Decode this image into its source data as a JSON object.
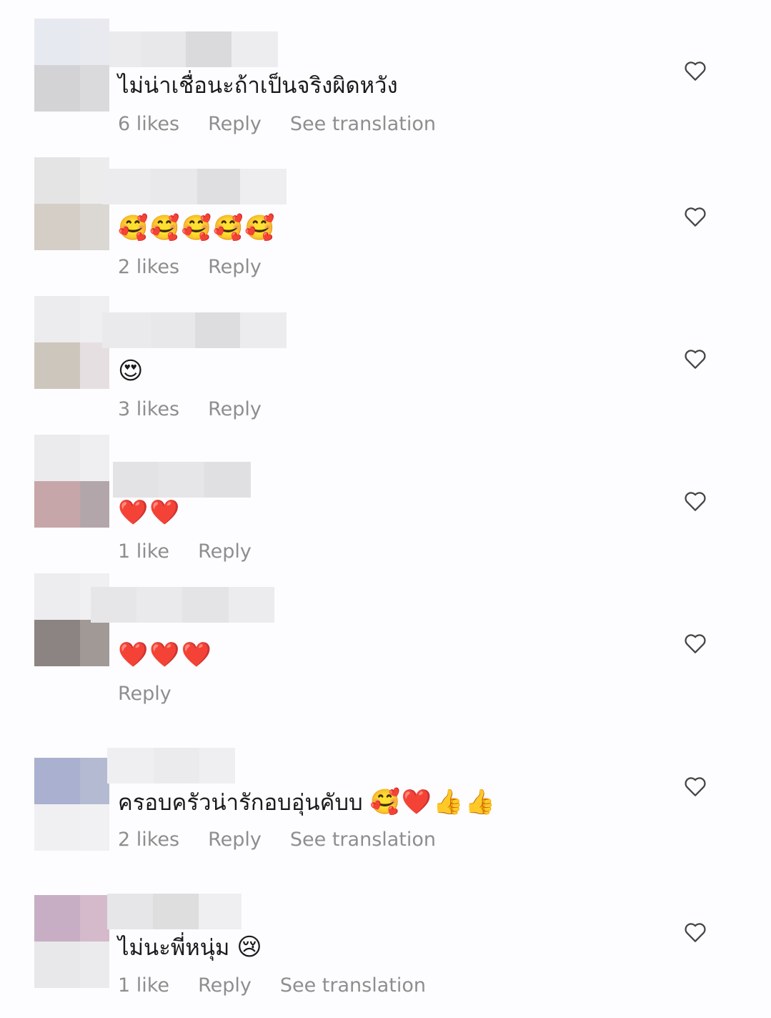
{
  "comments": [
    {
      "text": "ไม่น่าเชื่อนะถ้าเป็นจริงผิดหวัง",
      "emoji": "",
      "likes": "6 likes",
      "reply": "Reply",
      "translate": "See translation"
    },
    {
      "text": "",
      "emoji": "🥰🥰🥰🥰🥰",
      "likes": "2 likes",
      "reply": "Reply",
      "translate": ""
    },
    {
      "text": "",
      "emoji": "😍",
      "likes": "3 likes",
      "reply": "Reply",
      "translate": ""
    },
    {
      "text": "",
      "emoji": "❤️❤️",
      "likes": "1 like",
      "reply": "Reply",
      "translate": ""
    },
    {
      "text": "",
      "emoji": "❤️❤️❤️",
      "likes": "",
      "reply": "Reply",
      "translate": ""
    },
    {
      "text": "ครอบครัวน่ารักอบอุ่นคับบ ",
      "emoji": "🥰❤️👍👍",
      "likes": "2 likes",
      "reply": "Reply",
      "translate": "See translation"
    },
    {
      "text": "ไม่นะพี่หนุ่ม ",
      "emoji": "😢",
      "likes": "1 like",
      "reply": "Reply",
      "translate": "See translation"
    }
  ],
  "icons": {
    "like": "heart-outline-icon"
  },
  "colors": {
    "secondary_text": "#8e8e8e",
    "primary_text": "#1a1a1a"
  }
}
